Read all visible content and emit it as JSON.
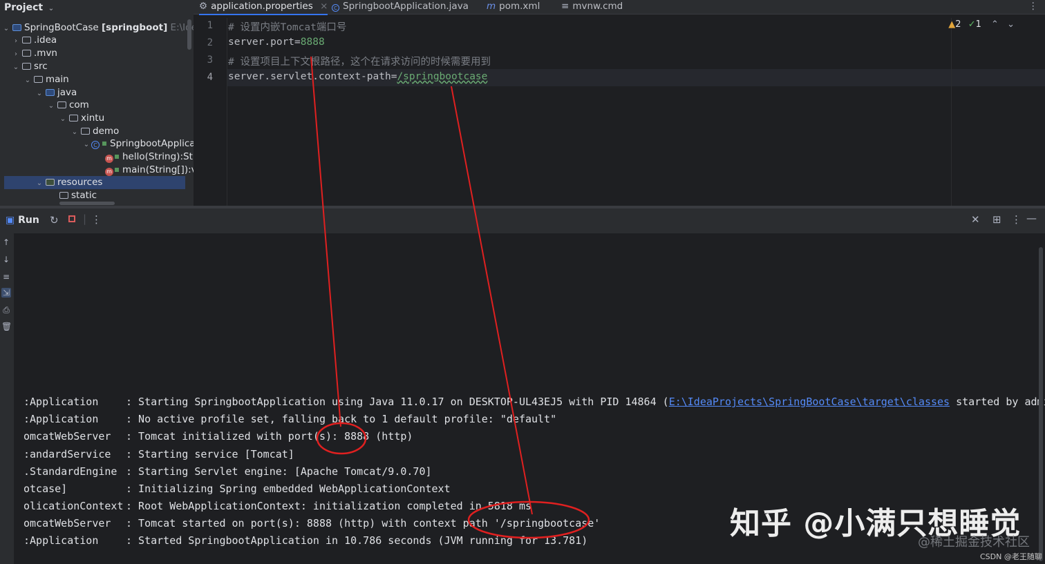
{
  "project": {
    "header": "Project",
    "root_name": "SpringBootCase",
    "root_module": "[springboot]",
    "root_path": "E:\\IdeaP",
    "tree": [
      {
        "label": ".idea"
      },
      {
        "label": ".mvn"
      },
      {
        "label": "src"
      },
      {
        "label": "main"
      },
      {
        "label": "java"
      },
      {
        "label": "com"
      },
      {
        "label": "xintu"
      },
      {
        "label": "demo"
      },
      {
        "label": "SpringbootApplica"
      },
      {
        "label": "hello(String):Str"
      },
      {
        "label": "main(String[]):v"
      },
      {
        "label": "resources"
      },
      {
        "label": "static"
      }
    ]
  },
  "tabs": [
    {
      "label": "application.properties",
      "active": true
    },
    {
      "label": "SpringbootApplication.java"
    },
    {
      "label": "pom.xml"
    },
    {
      "label": "mvnw.cmd"
    }
  ],
  "editor": {
    "line_numbers": [
      "1",
      "2",
      "3",
      "4"
    ],
    "line1_comment": "# 设置内嵌Tomcat端口号",
    "line2_key": "server.port=",
    "line2_value": "8888",
    "line3_comment": "# 设置项目上下文根路径，这个在请求访问的时候需要用到",
    "line4_key": "server.servlet.context-path=",
    "line4_value": "/springbootcase",
    "warnings": "2",
    "weak_warnings": "1"
  },
  "run": {
    "title": "Run",
    "log": [
      {
        "src": ":Application",
        "msg": ": Starting SpringbootApplication using Java 11.0.17 on DESKTOP-UL43EJ5 with PID 14864 (",
        "link": "E:\\IdeaProjects\\SpringBootCase\\target\\classes",
        "tail": " started by admin in"
      },
      {
        "src": ":Application",
        "msg": ": No active profile set, falling back to 1 default profile: \"default\""
      },
      {
        "src": "omcatWebServer",
        "msg": ": Tomcat initialized with port(s): 8888 (http)"
      },
      {
        "src": ":andardService",
        "msg": ": Starting service [Tomcat]"
      },
      {
        "src": ".StandardEngine",
        "msg": ": Starting Servlet engine: [Apache Tomcat/9.0.70]"
      },
      {
        "src": "otcase]",
        "msg": ": Initializing Spring embedded WebApplicationContext"
      },
      {
        "src": "olicationContext",
        "msg": ": Root WebApplicationContext: initialization completed in 5818 ms"
      },
      {
        "src": "omcatWebServer",
        "msg": ": Tomcat started on port(s): 8888 (http) with context path '/springbootcase'"
      },
      {
        "src": ":Application",
        "msg": ": Started SpringbootApplication in 10.786 seconds (JVM running for 13.781)"
      }
    ]
  },
  "watermarks": {
    "main": "知乎 @小满只想睡觉",
    "sub": "@稀土掘金技术社区",
    "csdn": "CSDN @老王随聊"
  },
  "colors": {
    "annotation": "#e02020",
    "accent": "#3574f0"
  }
}
